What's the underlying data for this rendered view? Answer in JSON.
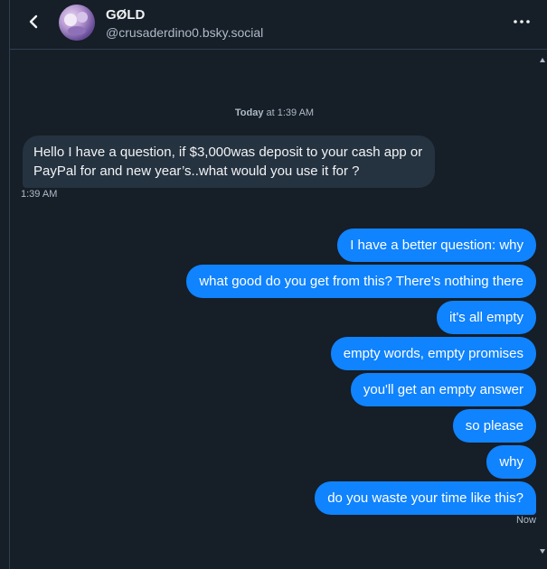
{
  "header": {
    "name": "GØLD",
    "handle": "@crusaderdino0.bsky.social"
  },
  "conversation": {
    "divider_day": "Today",
    "divider_time": " at 1:39 AM",
    "incoming": [
      {
        "text": "Hello I have a question, if $3,000was deposit to your cash app or PayPal for and new year’s..what would you use it for ?",
        "time": "1:39 AM"
      }
    ],
    "outgoing": [
      {
        "text": "I have a better question: why"
      },
      {
        "text": "what good do you get from this? There's nothing there"
      },
      {
        "text": "it's all empty"
      },
      {
        "text": "empty words, empty promises"
      },
      {
        "text": "you'll get an empty answer"
      },
      {
        "text": "so please"
      },
      {
        "text": "why"
      },
      {
        "text": "do you waste your time like this?"
      }
    ],
    "outgoing_time": "Now"
  },
  "colors": {
    "background": "#161e27",
    "incoming_bubble": "#253240",
    "outgoing_bubble": "#1083fe",
    "muted_text": "#aebbc9"
  },
  "icons": {
    "back": "chevron-left-icon",
    "more": "ellipsis-icon"
  }
}
